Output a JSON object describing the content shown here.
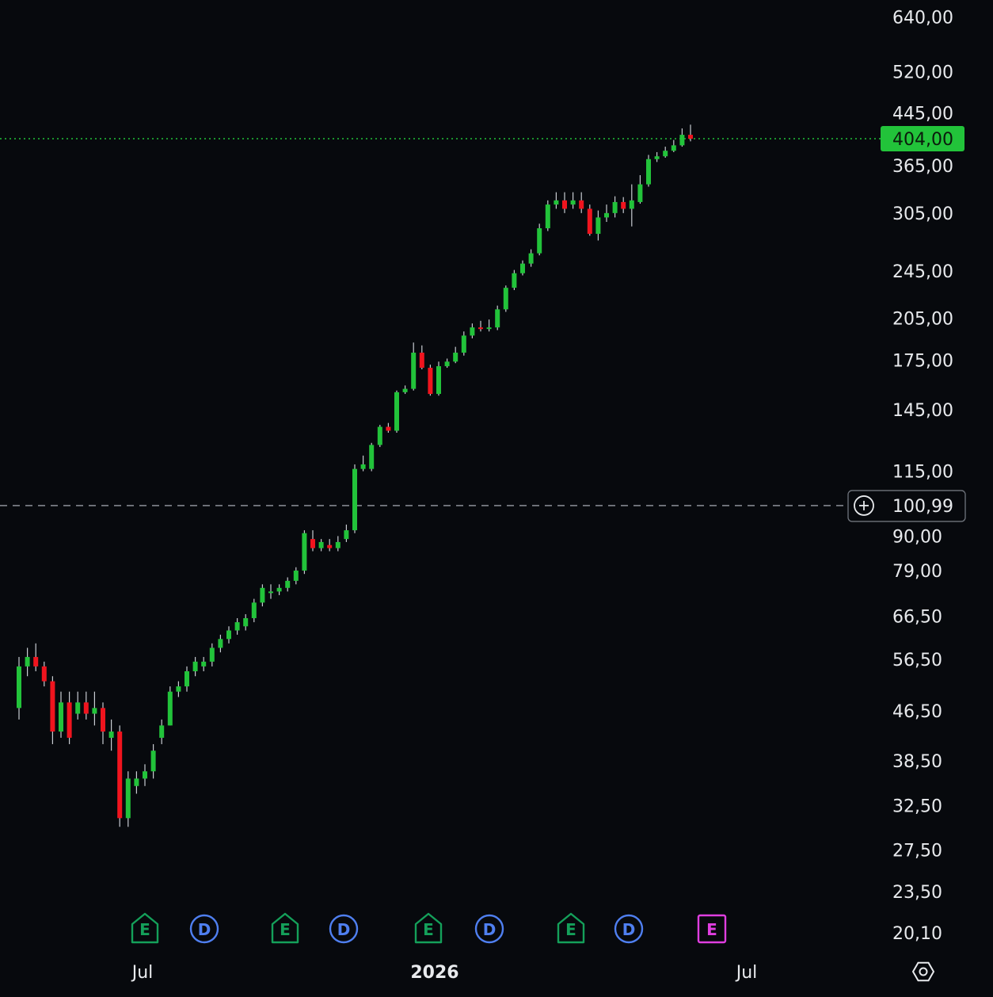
{
  "chart_data": {
    "type": "candlestick",
    "scale": "log",
    "grid": false,
    "price_axis_ticks": [
      640,
      520,
      445,
      365,
      305,
      245,
      205,
      175,
      145,
      115,
      90,
      79,
      66.5,
      56.5,
      46.5,
      38.5,
      32.5,
      27.5,
      23.5,
      20.1
    ],
    "price_axis_labels": [
      "640,00",
      "520,00",
      "445,00",
      "365,00",
      "305,00",
      "245,00",
      "205,00",
      "175,00",
      "145,00",
      "115,00",
      "90,00",
      "79,00",
      "66,50",
      "56,50",
      "46,50",
      "38,50",
      "32,50",
      "27,50",
      "23,50",
      "20,10"
    ],
    "x_axis_labels": [
      "Jul",
      "2026",
      "Jul"
    ],
    "last_price": {
      "value": 404,
      "label": "404,00",
      "color": "#22c33a"
    },
    "crosshair_price": {
      "value": 100.99,
      "label": "100,99"
    },
    "events": [
      {
        "type": "E",
        "color": "#14a05a"
      },
      {
        "type": "D",
        "color": "#4f7ff0"
      },
      {
        "type": "E",
        "color": "#14a05a"
      },
      {
        "type": "D",
        "color": "#4f7ff0"
      },
      {
        "type": "E",
        "color": "#14a05a"
      },
      {
        "type": "D",
        "color": "#4f7ff0"
      },
      {
        "type": "E",
        "color": "#14a05a"
      },
      {
        "type": "D",
        "color": "#4f7ff0"
      },
      {
        "type": "E",
        "color": "#e03ee0"
      }
    ],
    "colors": {
      "up": "#22c33a",
      "down": "#f0141e",
      "wick": "#c8ccd2"
    },
    "candles": [
      [
        47,
        55,
        45,
        57
      ],
      [
        55,
        57,
        53,
        59
      ],
      [
        57,
        55,
        54,
        60
      ],
      [
        55,
        52,
        51,
        56
      ],
      [
        52,
        43,
        41,
        53
      ],
      [
        43,
        48,
        42,
        50
      ],
      [
        48,
        42,
        41,
        50
      ],
      [
        46,
        48,
        45,
        50
      ],
      [
        48,
        46,
        45,
        50
      ],
      [
        46,
        47,
        44,
        50
      ],
      [
        47,
        43,
        41,
        48
      ],
      [
        42,
        43,
        40,
        45
      ],
      [
        43,
        31,
        30,
        44
      ],
      [
        31,
        36,
        30,
        37
      ],
      [
        35,
        36,
        34,
        37
      ],
      [
        36,
        37,
        35,
        38
      ],
      [
        37,
        40,
        36,
        41
      ],
      [
        42,
        44,
        41,
        45
      ],
      [
        44,
        50,
        44,
        51
      ],
      [
        50,
        51,
        49,
        52
      ],
      [
        51,
        54,
        50,
        55
      ],
      [
        54,
        56,
        53,
        57
      ],
      [
        55,
        56,
        54,
        57
      ],
      [
        56,
        59,
        55,
        60
      ],
      [
        59,
        61,
        58,
        62
      ],
      [
        61,
        63,
        60,
        64
      ],
      [
        63,
        65,
        62,
        66
      ],
      [
        64,
        66,
        63,
        67
      ],
      [
        66,
        70,
        65,
        71
      ],
      [
        70,
        74,
        69,
        75
      ],
      [
        73,
        73,
        71,
        75
      ],
      [
        73,
        74,
        72,
        75
      ],
      [
        74,
        76,
        73,
        77
      ],
      [
        76,
        79,
        75,
        80
      ],
      [
        79,
        91,
        78,
        92
      ],
      [
        89,
        86,
        85,
        92
      ],
      [
        86,
        88,
        85,
        89
      ],
      [
        87,
        86,
        85,
        89
      ],
      [
        86,
        88,
        85,
        90
      ],
      [
        89,
        92,
        88,
        94
      ],
      [
        92,
        116,
        91,
        118
      ],
      [
        116,
        118,
        115,
        122
      ],
      [
        116,
        127,
        115,
        128
      ],
      [
        127,
        136,
        126,
        137
      ],
      [
        136,
        134,
        133,
        138
      ],
      [
        134,
        155,
        133,
        156
      ],
      [
        155,
        157,
        154,
        159
      ],
      [
        157,
        180,
        156,
        187
      ],
      [
        180,
        170,
        169,
        185
      ],
      [
        170,
        154,
        153,
        172
      ],
      [
        154,
        171,
        153,
        174
      ],
      [
        171,
        174,
        170,
        176
      ],
      [
        174,
        180,
        173,
        184
      ],
      [
        180,
        192,
        178,
        195
      ],
      [
        192,
        198,
        190,
        201
      ],
      [
        198,
        197,
        195,
        203
      ],
      [
        197,
        198,
        195,
        204
      ],
      [
        198,
        212,
        196,
        215
      ],
      [
        212,
        230,
        210,
        232
      ],
      [
        230,
        243,
        228,
        246
      ],
      [
        243,
        252,
        241,
        255
      ],
      [
        252,
        262,
        249,
        266
      ],
      [
        262,
        288,
        260,
        293
      ],
      [
        288,
        315,
        285,
        320
      ],
      [
        315,
        320,
        310,
        330
      ],
      [
        320,
        310,
        305,
        330
      ],
      [
        315,
        320,
        310,
        330
      ],
      [
        320,
        310,
        305,
        330
      ],
      [
        310,
        282,
        280,
        315
      ],
      [
        282,
        300,
        275,
        308
      ],
      [
        300,
        305,
        295,
        315
      ],
      [
        305,
        318,
        300,
        325
      ],
      [
        318,
        310,
        305,
        324
      ],
      [
        310,
        320,
        290,
        340
      ],
      [
        318,
        340,
        316,
        352
      ],
      [
        340,
        374,
        337,
        380
      ],
      [
        374,
        378,
        370,
        384
      ],
      [
        378,
        386,
        376,
        392
      ],
      [
        386,
        394,
        384,
        402
      ],
      [
        394,
        410,
        392,
        420
      ],
      [
        410,
        404,
        400,
        426
      ]
    ]
  }
}
